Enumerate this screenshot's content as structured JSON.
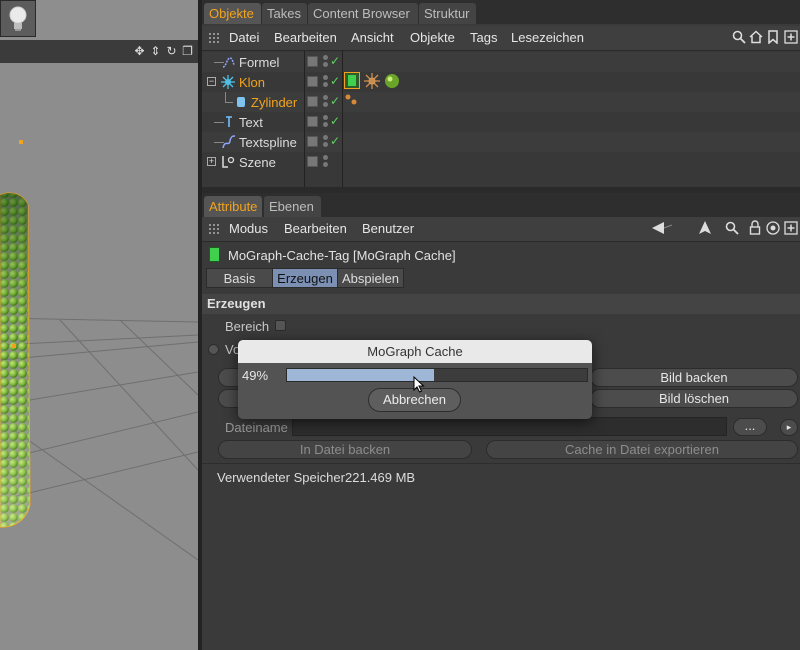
{
  "objects_panel": {
    "tabs": [
      "Objekte",
      "Takes",
      "Content Browser",
      "Struktur"
    ],
    "menu": [
      "Datei",
      "Bearbeiten",
      "Ansicht",
      "Objekte",
      "Tags",
      "Lesezeichen"
    ],
    "items": [
      {
        "name": "Formel"
      },
      {
        "name": "Klon"
      },
      {
        "name": "Zylinder"
      },
      {
        "name": "Text"
      },
      {
        "name": "Textspline"
      },
      {
        "name": "Szene"
      }
    ]
  },
  "attributes_panel": {
    "tabs": [
      "Attribute",
      "Ebenen"
    ],
    "menu": [
      "Modus",
      "Bearbeiten",
      "Benutzer"
    ],
    "tag_title": "MoGraph-Cache-Tag [MoGraph Cache]",
    "subtabs": [
      "Basis",
      "Erzeugen",
      "Abspielen"
    ],
    "group_title": "Erzeugen",
    "bereich_label": "Bereich",
    "partial_label": "Vo",
    "bake_frame_button": "Bild backen",
    "delete_frame_button": "Bild löschen",
    "filename_label": "Dateiname",
    "browse_button": "...",
    "bake_to_file_button": "In Datei backen",
    "export_cache_button": "Cache in Datei exportieren",
    "memory_label": "Verwendeter Speicher",
    "memory_value": "221.469 MB"
  },
  "dialog": {
    "title": "MoGraph Cache",
    "progress_text": "49%",
    "progress": 0.49,
    "cancel_button": "Abbrechen"
  },
  "colors": {
    "accent": "#f2a31d",
    "progress_fill": "#9fb7d6",
    "active_subtab": "#7c90b4"
  }
}
